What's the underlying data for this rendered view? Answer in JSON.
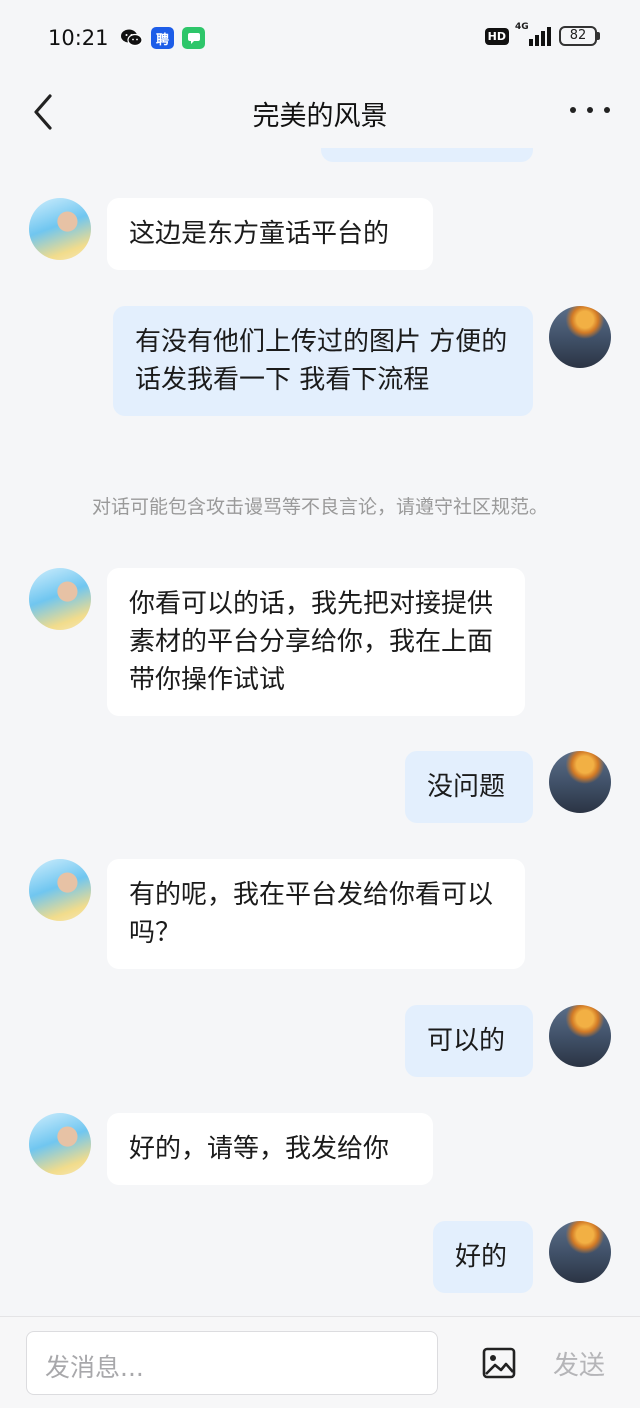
{
  "status_bar": {
    "time": "10:21",
    "hd_label": "HD",
    "network_label": "4G",
    "battery": "82",
    "app_icons": [
      "wechat-icon",
      "recruit-app-icon",
      "messages-app-icon"
    ],
    "recruit_app_glyph": "聘"
  },
  "nav": {
    "title": "完美的风景",
    "back_icon": "back-arrow-icon",
    "more_icon": "more-dots-icon"
  },
  "messages": [
    {
      "side": "left",
      "text": "这边是东方童话平台的"
    },
    {
      "side": "right",
      "text": "有没有他们上传过的图片 方便的话发我看一下  我看下流程"
    },
    {
      "side": "left",
      "text": "你看可以的话，我先把对接提供素材的平台分享给你，我在上面带你操作试试"
    },
    {
      "side": "right",
      "text": "没问题"
    },
    {
      "side": "left",
      "text": "有的呢，我在平台发给你看可以吗？"
    },
    {
      "side": "right",
      "text": "可以的"
    },
    {
      "side": "left",
      "text": "好的，请等，我发给你"
    },
    {
      "side": "right",
      "text": "好的"
    }
  ],
  "notice": "对话可能包含攻击谩骂等不良言论，请遵守社区规范。",
  "composer": {
    "placeholder": "发消息...",
    "image_icon": "image-icon",
    "send_label": "发送"
  },
  "colors": {
    "background": "#f5f6f8",
    "left_bubble": "#ffffff",
    "right_bubble": "#e3effd",
    "notice_text": "#9a9a9a",
    "send_disabled": "#b5b5b8"
  }
}
